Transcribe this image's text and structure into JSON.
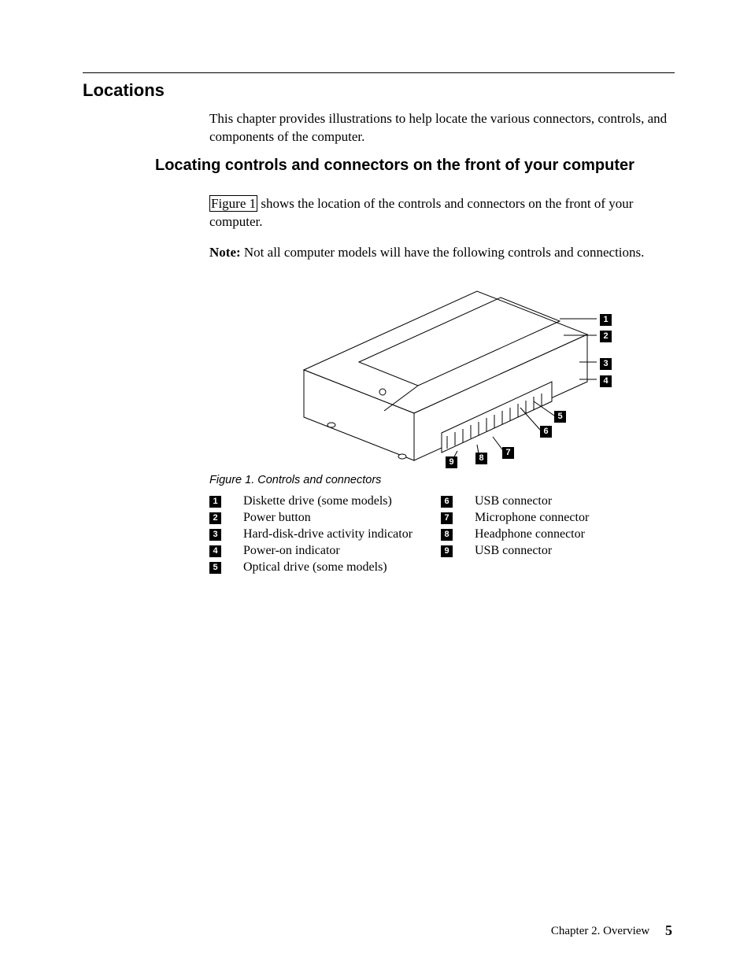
{
  "heading1": "Locations",
  "intro": "This chapter provides illustrations to help locate the various connectors, controls, and components of the computer.",
  "heading2": "Locating controls and connectors on the front of your computer",
  "para1_pre": "",
  "xref_label": "Figure 1",
  "para1_post": " shows the location of the controls and connectors on the front of your computer.",
  "note_label": "Note:",
  "note_text": "Not all computer models will have the following controls and connections.",
  "figure_caption": "Figure 1. Controls and connectors",
  "legend": {
    "left": [
      {
        "n": "1",
        "label": "Diskette drive (some models)"
      },
      {
        "n": "2",
        "label": "Power button"
      },
      {
        "n": "3",
        "label": "Hard-disk-drive activity indicator"
      },
      {
        "n": "4",
        "label": "Power-on indicator"
      },
      {
        "n": "5",
        "label": "Optical drive (some models)"
      }
    ],
    "right": [
      {
        "n": "6",
        "label": "USB connector"
      },
      {
        "n": "7",
        "label": "Microphone connector"
      },
      {
        "n": "8",
        "label": "Headphone connector"
      },
      {
        "n": "9",
        "label": "USB connector"
      }
    ]
  },
  "callouts": [
    "1",
    "2",
    "3",
    "4",
    "5",
    "6",
    "7",
    "8",
    "9"
  ],
  "footer": {
    "chapter": "Chapter 2. Overview",
    "page": "5"
  }
}
